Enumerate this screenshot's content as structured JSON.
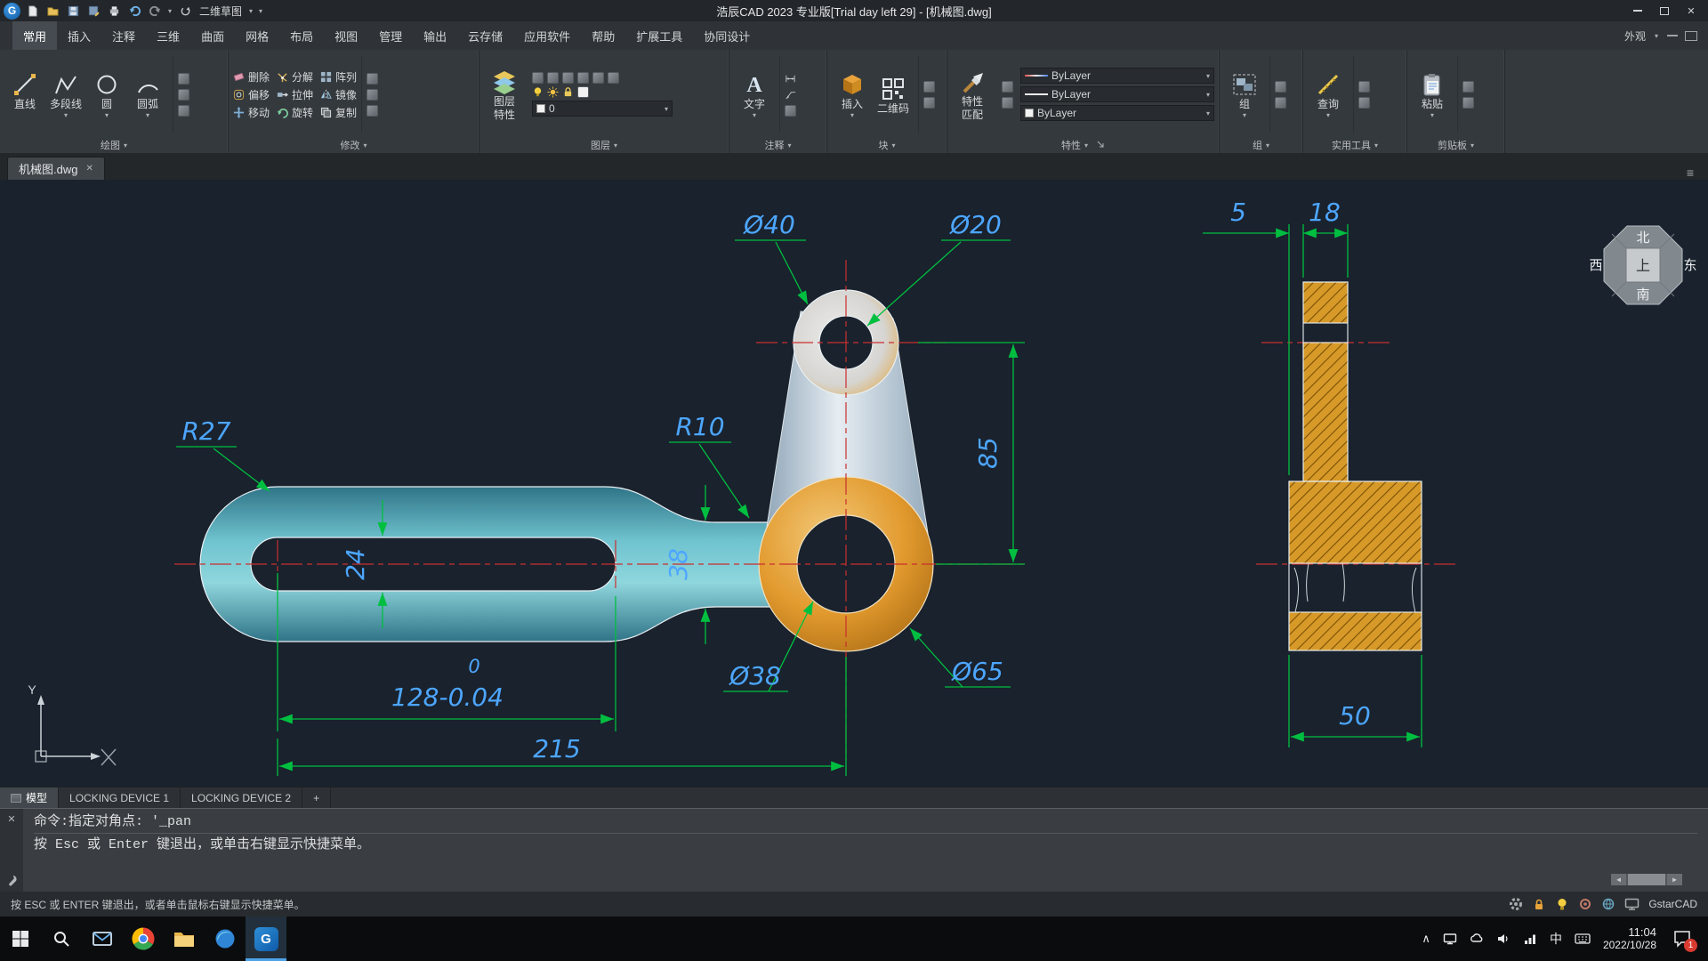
{
  "window": {
    "title": "浩辰CAD 2023 专业版[Trial day left 29] - [机械图.dwg]",
    "workspace": "二维草图",
    "logo_letter": "G"
  },
  "icons": {
    "chevron_down": "▾",
    "chevron_up": "∧",
    "close": "✕",
    "scroll_left": "◀",
    "scroll_right": "▶",
    "menu": "≡"
  },
  "menu": {
    "tabs": [
      "常用",
      "插入",
      "注释",
      "三维",
      "曲面",
      "网格",
      "布局",
      "视图",
      "管理",
      "输出",
      "云存储",
      "应用软件",
      "帮助",
      "扩展工具",
      "协同设计"
    ],
    "appearance_label": "外观"
  },
  "ribbon": {
    "draw": {
      "label": "绘图",
      "line": "直线",
      "polyline": "多段线",
      "circle": "圆",
      "arc": "圆弧"
    },
    "modify": {
      "label": "修改",
      "erase": "删除",
      "explode": "分解",
      "array": "阵列",
      "offset": "偏移",
      "stretch": "拉伸",
      "mirror": "镜像",
      "move": "移动",
      "rotate": "旋转",
      "copy": "复制"
    },
    "layers": {
      "label": "图层",
      "props_l1": "图层",
      "props_l2": "特性",
      "current_layer": "0"
    },
    "annotation": {
      "label": "注释",
      "text": "文字"
    },
    "block": {
      "label": "块",
      "insert": "插入",
      "qrcode": "二维码"
    },
    "properties": {
      "label": "特性",
      "match_l1": "特性",
      "match_l2": "匹配",
      "color": "ByLayer",
      "linetype": "ByLayer",
      "lineweight": "ByLayer"
    },
    "group": {
      "label": "组",
      "group": "组"
    },
    "utilities": {
      "label": "实用工具",
      "query": "查询"
    },
    "clipboard": {
      "label": "剪贴板",
      "paste": "粘贴"
    }
  },
  "document_tab": {
    "name": "机械图.dwg"
  },
  "drawing": {
    "dims": {
      "dia40": "Ø40",
      "dia20": "Ø20",
      "r27": "R27",
      "r10": "R10",
      "w24": "24",
      "w38": "38",
      "h85": "85",
      "tol_upper": "0",
      "len128": "128-0.04",
      "len215": "215",
      "dia38": "Ø38",
      "dia65": "Ø65",
      "off5": "5",
      "w18": "18",
      "w50": "50"
    },
    "compass": {
      "north": "北",
      "south": "南",
      "west": "西",
      "east": "东",
      "top": "上"
    },
    "ucs": {
      "y_label": "Y"
    },
    "colors": {
      "dimension_line": "#00bf40",
      "dimension_text": "#4da6ff",
      "centerline": "#c92f2f",
      "part_teal": "#4ba7b8",
      "part_orange": "#e09a2e"
    }
  },
  "layout_tabs": {
    "model": "模型",
    "tab1": "LOCKING DEVICE 1",
    "tab2": "LOCKING DEVICE 2",
    "add": "+"
  },
  "command": {
    "line1": "命令:指定对角点: '_pan",
    "line2": "按 Esc 或 Enter 键退出，或单击右键显示快捷菜单。"
  },
  "status_bar": {
    "hint": "按 ESC 或 ENTER 键退出，或者单击鼠标右键显示快捷菜单。",
    "brand": "GstarCAD"
  },
  "taskbar": {
    "time": "11:04",
    "date": "2022/10/28",
    "ime": "中",
    "badge": "1"
  }
}
